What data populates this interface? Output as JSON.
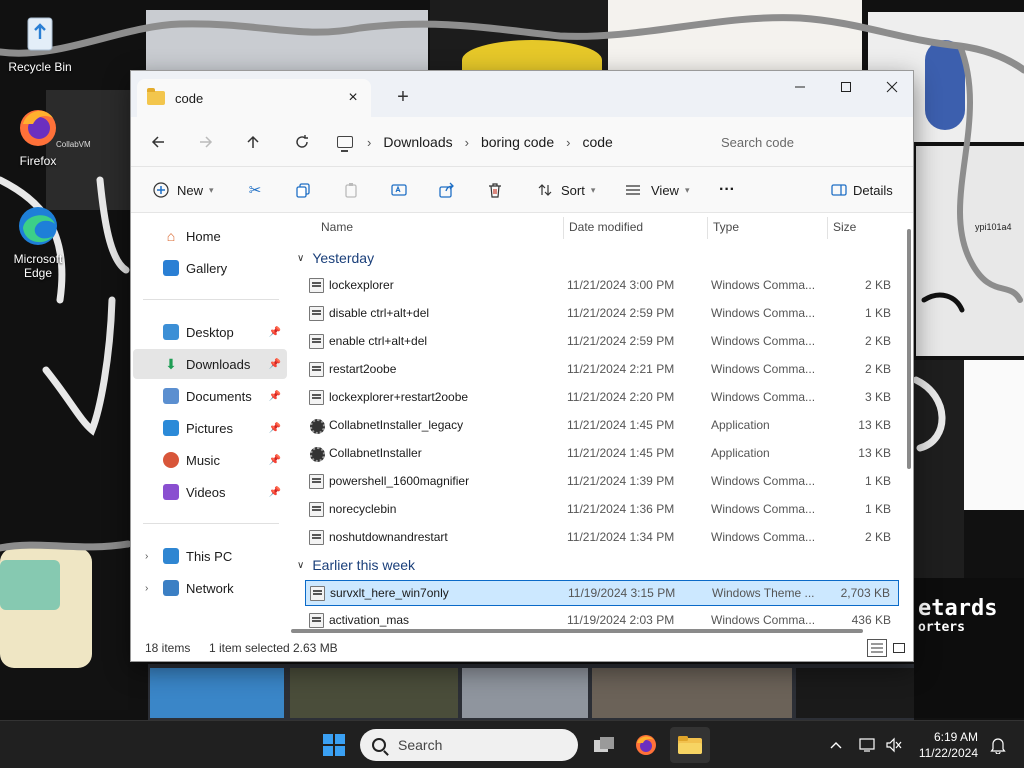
{
  "desktop": {
    "icons": [
      {
        "label": "Recycle Bin",
        "icon": "recycle-bin-icon"
      },
      {
        "label": "Firefox",
        "icon": "firefox-icon"
      },
      {
        "label": "Microsoft Edge",
        "icon": "edge-icon"
      }
    ],
    "background_snippets": {
      "bg_text_1": "CollabVM",
      "bg_text_2": "etards",
      "bg_text_3": "orters",
      "bg_text_4": "ypi101a4"
    }
  },
  "window": {
    "tab_title": "code",
    "tab_close": "×",
    "new_tab": "+",
    "minimize": "—",
    "maximize": "☐",
    "close": "✕",
    "breadcrumbs": [
      "Downloads",
      "boring code",
      "code"
    ],
    "breadcrumb_sep": "›",
    "search_placeholder": "Search code",
    "commands": {
      "new": "New",
      "sort": "Sort",
      "view": "View",
      "more": "···",
      "details": "Details"
    },
    "nav": {
      "home": "Home",
      "gallery": "Gallery",
      "desktop": "Desktop",
      "downloads": "Downloads",
      "documents": "Documents",
      "pictures": "Pictures",
      "music": "Music",
      "videos": "Videos",
      "this_pc": "This PC",
      "network": "Network"
    },
    "columns": {
      "name": "Name",
      "date": "Date modified",
      "type": "Type",
      "size": "Size"
    },
    "groups": {
      "yesterday": "Yesterday",
      "earlier": "Earlier this week"
    },
    "files": [
      {
        "name": "lockexplorer",
        "date": "11/21/2024 3:00 PM",
        "type": "Windows Comma...",
        "size": "2 KB",
        "kind": "cmd"
      },
      {
        "name": "disable ctrl+alt+del",
        "date": "11/21/2024 2:59 PM",
        "type": "Windows Comma...",
        "size": "1 KB",
        "kind": "cmd"
      },
      {
        "name": "enable ctrl+alt+del",
        "date": "11/21/2024 2:59 PM",
        "type": "Windows Comma...",
        "size": "2 KB",
        "kind": "cmd"
      },
      {
        "name": "restart2oobe",
        "date": "11/21/2024 2:21 PM",
        "type": "Windows Comma...",
        "size": "2 KB",
        "kind": "cmd"
      },
      {
        "name": "lockexplorer+restart2oobe",
        "date": "11/21/2024 2:20 PM",
        "type": "Windows Comma...",
        "size": "3 KB",
        "kind": "cmd"
      },
      {
        "name": "CollabnetInstaller_legacy",
        "date": "11/21/2024 1:45 PM",
        "type": "Application",
        "size": "13 KB",
        "kind": "app"
      },
      {
        "name": "CollabnetInstaller",
        "date": "11/21/2024 1:45 PM",
        "type": "Application",
        "size": "13 KB",
        "kind": "app"
      },
      {
        "name": "powershell_1600magnifier",
        "date": "11/21/2024 1:39 PM",
        "type": "Windows Comma...",
        "size": "1 KB",
        "kind": "cmd"
      },
      {
        "name": "norecyclebin",
        "date": "11/21/2024 1:36 PM",
        "type": "Windows Comma...",
        "size": "1 KB",
        "kind": "cmd"
      },
      {
        "name": "noshutdownandrestart",
        "date": "11/21/2024 1:34 PM",
        "type": "Windows Comma...",
        "size": "2 KB",
        "kind": "cmd"
      },
      {
        "name": "survxlt_here_win7only",
        "date": "11/19/2024 3:15 PM",
        "type": "Windows Theme ...",
        "size": "2,703 KB",
        "kind": "theme",
        "selected": true
      },
      {
        "name": "activation_mas",
        "date": "11/19/2024 2:03 PM",
        "type": "Windows Comma...",
        "size": "436 KB",
        "kind": "cmd"
      }
    ],
    "status": {
      "items": "18 items",
      "selected": "1 item selected",
      "size": "2.63 MB"
    }
  },
  "taskbar": {
    "search_label": "Search",
    "time": "6:19 AM",
    "date": "11/22/2024"
  },
  "colors": {
    "accent": "#0a6ac8",
    "selection": "#cce8ff",
    "taskbar": "#202020"
  }
}
